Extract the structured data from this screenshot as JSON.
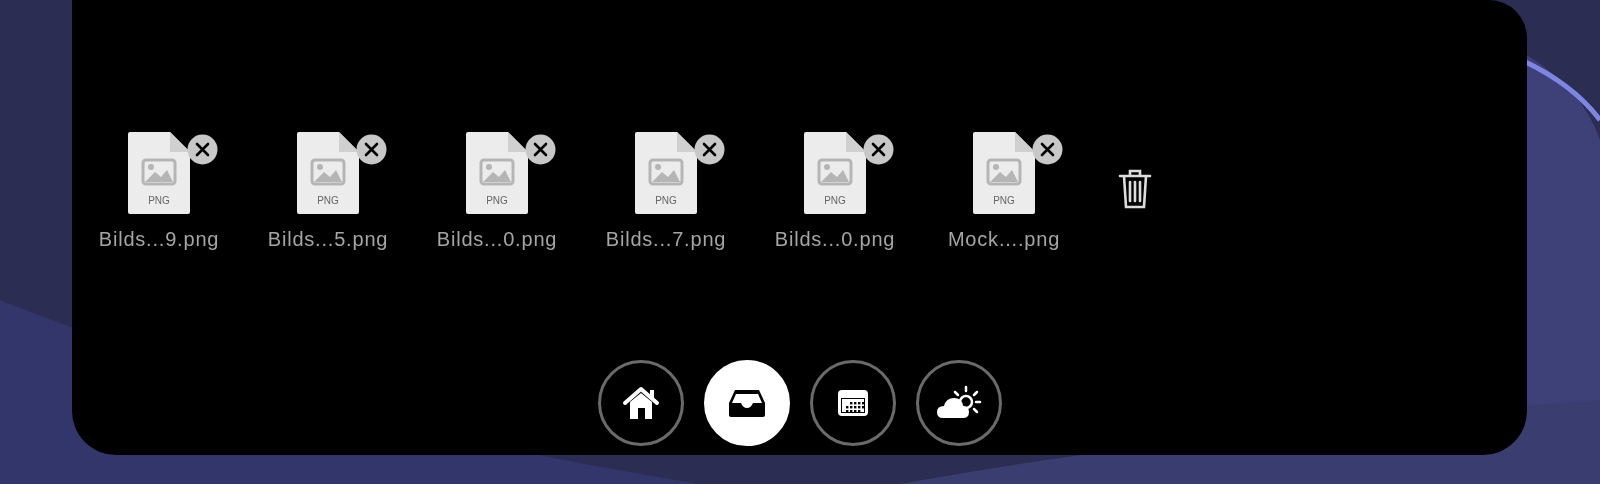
{
  "shelf": {
    "files": [
      {
        "name": "Bilds...9.png",
        "type_label": "PNG"
      },
      {
        "name": "Bilds...5.png",
        "type_label": "PNG"
      },
      {
        "name": "Bilds...0.png",
        "type_label": "PNG"
      },
      {
        "name": "Bilds...7.png",
        "type_label": "PNG"
      },
      {
        "name": "Bilds...0.png",
        "type_label": "PNG"
      },
      {
        "name": "Mock....png",
        "type_label": "PNG"
      }
    ]
  },
  "nav": [
    {
      "kind": "home",
      "selected": false
    },
    {
      "kind": "tray",
      "selected": true
    },
    {
      "kind": "calendar",
      "selected": false
    },
    {
      "kind": "weather",
      "selected": false
    }
  ]
}
